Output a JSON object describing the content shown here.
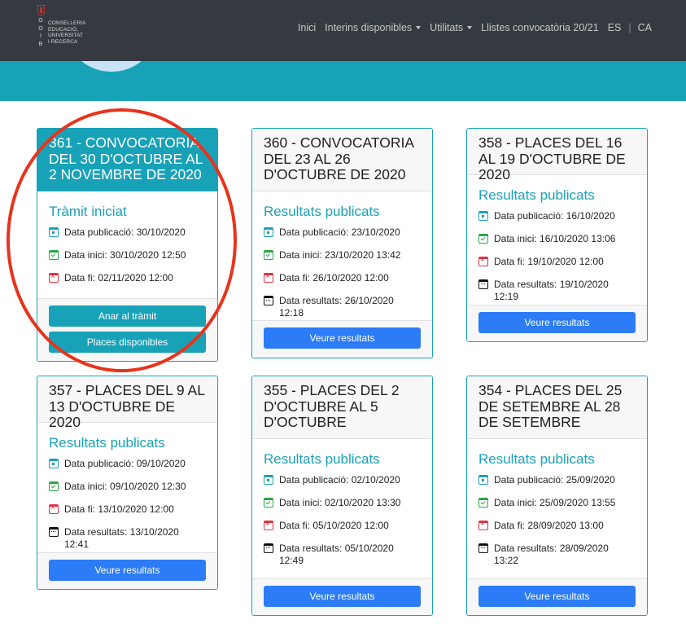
{
  "header": {
    "logo_letters": [
      "G",
      "O",
      "I",
      "B"
    ],
    "logo_text": [
      "CONSELLERIA",
      "EDUCACIÓ,",
      "UNIVERSITAT",
      "I RECERCA"
    ],
    "nav": {
      "inici": "Inici",
      "interins": "Interins disponibles",
      "utilitats": "Utilitats",
      "llistes": "Llistes convocatòria 20/21",
      "lang_es": "ES",
      "lang_sep": "|",
      "lang_ca": "CA"
    }
  },
  "cards": [
    {
      "title": "361 - CONVOCATORIA DEL 30 D'OCTUBRE AL 2 NOVEMBRE DE 2020",
      "status": "Tràmit iniciat",
      "rows": [
        "Data publicació: 30/10/2020",
        "Data inici: 30/10/2020 12:50",
        "Data fi: 02/11/2020 12:00"
      ],
      "buttons": [
        "Anar al tràmit",
        "Places disponibles"
      ]
    },
    {
      "title": "360 - CONVOCATORIA DEL 23 AL 26 D'OCTUBRE DE 2020",
      "status": "Resultats publicats",
      "rows": [
        "Data publicació: 23/10/2020",
        "Data inici: 23/10/2020 13:42",
        "Data fi: 26/10/2020 12:00",
        "Data resultats: 26/10/2020 12:18"
      ],
      "buttons": [
        "Veure resultats"
      ]
    },
    {
      "title": "358 - PLACES DEL 16 AL 19 D'OCTUBRE DE 2020",
      "status": "Resultats publicats",
      "rows": [
        "Data publicació: 16/10/2020",
        "Data inici: 16/10/2020 13:06",
        "Data fi: 19/10/2020 12:00",
        "Data resultats: 19/10/2020 12:19"
      ],
      "buttons": [
        "Veure resultats"
      ]
    },
    {
      "title": "357 - PLACES DEL 9 AL 13 D'OCTUBRE DE 2020",
      "status": "Resultats publicats",
      "rows": [
        "Data publicació: 09/10/2020",
        "Data inici: 09/10/2020 12:30",
        "Data fi: 13/10/2020 12:00",
        "Data resultats: 13/10/2020 12:41"
      ],
      "buttons": [
        "Veure resultats"
      ]
    },
    {
      "title": "355 - PLACES DEL 2 D'OCTUBRE AL 5 D'OCTUBRE",
      "status": "Resultats publicats",
      "rows": [
        "Data publicació: 02/10/2020",
        "Data inici: 02/10/2020 13:30",
        "Data fi: 05/10/2020 12:00",
        "Data resultats: 05/10/2020 12:49"
      ],
      "buttons": [
        "Veure resultats"
      ]
    },
    {
      "title": "354 - PLACES DEL 25 DE SETEMBRE AL 28 DE SETEMBRE",
      "status": "Resultats publicats",
      "rows": [
        "Data publicació: 25/09/2020",
        "Data inici: 25/09/2020 13:55",
        "Data fi: 28/09/2020 13:00",
        "Data resultats: 28/09/2020 13:22"
      ],
      "buttons": [
        "Veure resultats"
      ]
    }
  ],
  "colors": {
    "navbar": "#343a40",
    "accent": "#17a2b8",
    "button_primary": "#2b7cf6",
    "annotation": "#e8331c"
  }
}
